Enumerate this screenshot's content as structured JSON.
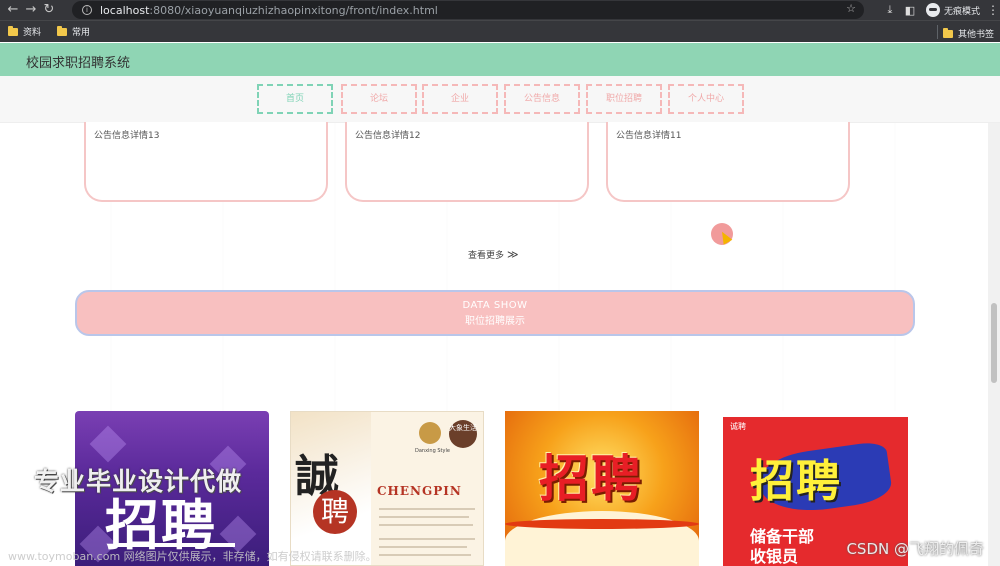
{
  "browser": {
    "url_host": "localhost",
    "url_rest": ":8080/xiaoyuanqiuzhizhaopinxitong/front/index.html",
    "incognito_label": "无痕模式",
    "bookmarks": [
      {
        "label": "资料"
      },
      {
        "label": "常用"
      }
    ],
    "other_bookmarks_label": "其他书签"
  },
  "site": {
    "title": "校园求职招聘系统",
    "nav": [
      {
        "label": "首页",
        "active": true
      },
      {
        "label": "论坛",
        "active": false
      },
      {
        "label": "企业",
        "active": false
      },
      {
        "label": "公告信息",
        "active": false
      },
      {
        "label": "职位招聘",
        "active": false
      },
      {
        "label": "个人中心",
        "active": false
      }
    ]
  },
  "notices": [
    {
      "title": "公告信息详情13"
    },
    {
      "title": "公告信息详情12"
    },
    {
      "title": "公告信息详情11"
    }
  ],
  "more_link": {
    "label": "查看更多",
    "arrow": "≫"
  },
  "data_show": {
    "title": "DATA SHOW",
    "subtitle": "职位招聘展示"
  },
  "jobs": [
    {
      "text": "招聘"
    },
    {
      "text_top": "誠",
      "text_bottom": "聘",
      "brand": "Danxing Style",
      "badge": "大象生活",
      "english": "CHENGPIN"
    },
    {
      "text": "招聘"
    },
    {
      "header": "诚聘",
      "text": "招聘",
      "footer_line1": "储备干部",
      "footer_line2": "收银员"
    }
  ],
  "overlays": {
    "watermark_big": "专业毕业设计代做",
    "watermark_bottom": "www.toymoban.com 网络图片仅供展示，非存储，如有侵权请联系删除。",
    "credit": "CSDN @飞翔的佩奇"
  }
}
